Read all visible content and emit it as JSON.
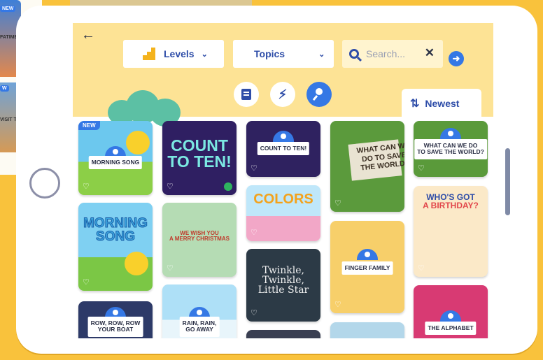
{
  "background": {
    "badge_new": "NEW",
    "label_1": "FATIME",
    "badge_new_2": "W",
    "label_2": "VISIT T"
  },
  "toolbar": {
    "levels_label": "Levels",
    "topics_label": "Topics",
    "search_placeholder": "Search...",
    "sort_label": "Newest"
  },
  "cards": {
    "morning_song_small": {
      "badge": "NEW",
      "label": "MORNING SONG"
    },
    "count_to_ten_art": {
      "title_line1": "COUNT",
      "title_line2": "TO TEN!"
    },
    "count_to_ten_small": {
      "label": "COUNT TO TEN!"
    },
    "save_the_world_art": {
      "title": "WHAT CAN WE DO TO SAVE THE WORLD?"
    },
    "save_the_world_small": {
      "label_line1": "WHAT CAN WE DO",
      "label_line2": "TO SAVE THE WORLD?"
    },
    "morning_song_art": {
      "title_line1": "MORNING",
      "title_line2": "SONG"
    },
    "merry_christmas": {
      "line1": "WE WISH YOU",
      "line2": "A MERRY CHRISTMAS"
    },
    "colors": {
      "title": "COLORS"
    },
    "who_got_birthday": {
      "line1": "WHO'S GOT",
      "line2": "A BIRTHDAY?"
    },
    "finger_family": {
      "label": "FINGER FAMILY"
    },
    "twinkle": {
      "line1": "Twinkle,",
      "line2": "Twinkle,",
      "line3": "Little Star"
    },
    "row_row": {
      "label_line1": "ROW, ROW, ROW",
      "label_line2": "YOUR BOAT"
    },
    "rain_rain": {
      "label_line1": "RAIN, RAIN,",
      "label_line2": "GO AWAY"
    },
    "alphabet": {
      "label": "THE ALPHABET"
    }
  },
  "colors": {
    "header_bg": "#fde395",
    "accent_blue": "#3578e5",
    "brand_yellow": "#f9c23c"
  }
}
